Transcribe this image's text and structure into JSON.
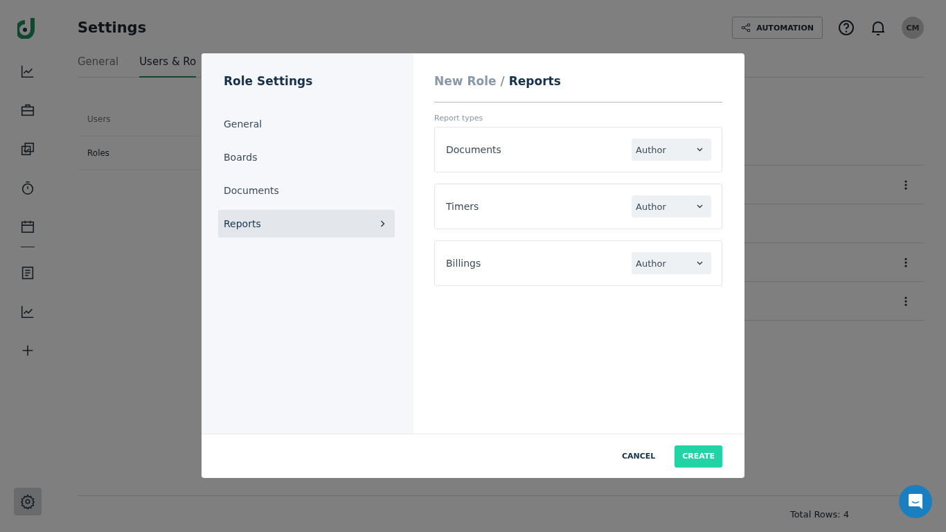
{
  "page": {
    "title": "Settings",
    "tabs": [
      {
        "label": "General",
        "selected": false
      },
      {
        "label": "Users & Ro",
        "selected": true
      }
    ],
    "subnav": [
      {
        "label": "Users",
        "selected": false
      },
      {
        "label": "Roles",
        "selected": true
      }
    ],
    "table_rows": [
      {
        "has_menu": true
      },
      {
        "has_menu": false
      },
      {
        "has_menu": true
      },
      {
        "has_menu": true
      }
    ],
    "footer": {
      "total": "Total Rows: 4"
    }
  },
  "header": {
    "automation": "AUTOMATION",
    "avatar": "CM"
  },
  "modal": {
    "title": "Role Settings",
    "nav": [
      {
        "label": "General",
        "selected": false
      },
      {
        "label": "Boards",
        "selected": false
      },
      {
        "label": "Documents",
        "selected": false
      },
      {
        "label": "Reports",
        "selected": true
      }
    ],
    "breadcrumb": {
      "parent": "New Role",
      "separator": "/",
      "current": "Reports"
    },
    "section_label": "Report types",
    "report_types": [
      {
        "label": "Documents",
        "value": "Author"
      },
      {
        "label": "Timers",
        "value": "Author"
      },
      {
        "label": "Billings",
        "value": "Author"
      }
    ],
    "buttons": [
      {
        "kind": "text",
        "label": "CANCEL"
      },
      {
        "kind": "primary",
        "label": "CREATE"
      }
    ]
  }
}
